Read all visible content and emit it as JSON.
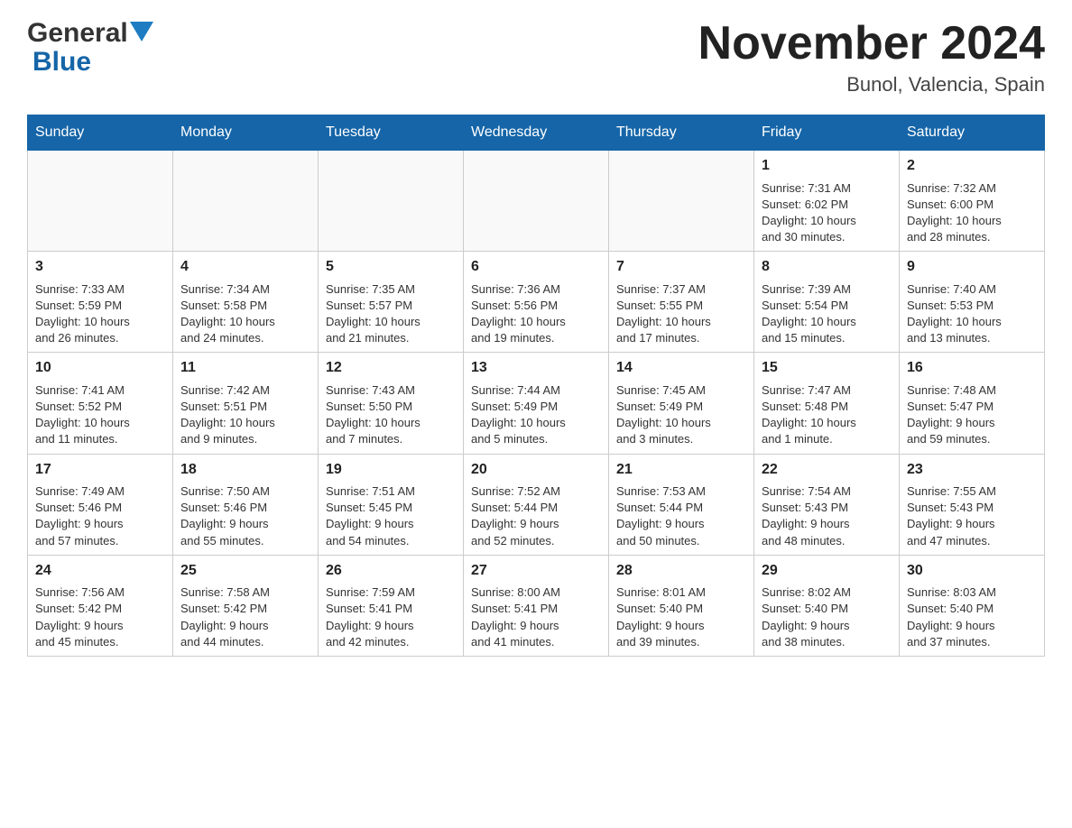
{
  "header": {
    "logo_general": "General",
    "logo_blue": "Blue",
    "month_title": "November 2024",
    "location": "Bunol, Valencia, Spain"
  },
  "weekdays": [
    "Sunday",
    "Monday",
    "Tuesday",
    "Wednesday",
    "Thursday",
    "Friday",
    "Saturday"
  ],
  "weeks": [
    [
      {
        "day": "",
        "info": ""
      },
      {
        "day": "",
        "info": ""
      },
      {
        "day": "",
        "info": ""
      },
      {
        "day": "",
        "info": ""
      },
      {
        "day": "",
        "info": ""
      },
      {
        "day": "1",
        "info": "Sunrise: 7:31 AM\nSunset: 6:02 PM\nDaylight: 10 hours\nand 30 minutes."
      },
      {
        "day": "2",
        "info": "Sunrise: 7:32 AM\nSunset: 6:00 PM\nDaylight: 10 hours\nand 28 minutes."
      }
    ],
    [
      {
        "day": "3",
        "info": "Sunrise: 7:33 AM\nSunset: 5:59 PM\nDaylight: 10 hours\nand 26 minutes."
      },
      {
        "day": "4",
        "info": "Sunrise: 7:34 AM\nSunset: 5:58 PM\nDaylight: 10 hours\nand 24 minutes."
      },
      {
        "day": "5",
        "info": "Sunrise: 7:35 AM\nSunset: 5:57 PM\nDaylight: 10 hours\nand 21 minutes."
      },
      {
        "day": "6",
        "info": "Sunrise: 7:36 AM\nSunset: 5:56 PM\nDaylight: 10 hours\nand 19 minutes."
      },
      {
        "day": "7",
        "info": "Sunrise: 7:37 AM\nSunset: 5:55 PM\nDaylight: 10 hours\nand 17 minutes."
      },
      {
        "day": "8",
        "info": "Sunrise: 7:39 AM\nSunset: 5:54 PM\nDaylight: 10 hours\nand 15 minutes."
      },
      {
        "day": "9",
        "info": "Sunrise: 7:40 AM\nSunset: 5:53 PM\nDaylight: 10 hours\nand 13 minutes."
      }
    ],
    [
      {
        "day": "10",
        "info": "Sunrise: 7:41 AM\nSunset: 5:52 PM\nDaylight: 10 hours\nand 11 minutes."
      },
      {
        "day": "11",
        "info": "Sunrise: 7:42 AM\nSunset: 5:51 PM\nDaylight: 10 hours\nand 9 minutes."
      },
      {
        "day": "12",
        "info": "Sunrise: 7:43 AM\nSunset: 5:50 PM\nDaylight: 10 hours\nand 7 minutes."
      },
      {
        "day": "13",
        "info": "Sunrise: 7:44 AM\nSunset: 5:49 PM\nDaylight: 10 hours\nand 5 minutes."
      },
      {
        "day": "14",
        "info": "Sunrise: 7:45 AM\nSunset: 5:49 PM\nDaylight: 10 hours\nand 3 minutes."
      },
      {
        "day": "15",
        "info": "Sunrise: 7:47 AM\nSunset: 5:48 PM\nDaylight: 10 hours\nand 1 minute."
      },
      {
        "day": "16",
        "info": "Sunrise: 7:48 AM\nSunset: 5:47 PM\nDaylight: 9 hours\nand 59 minutes."
      }
    ],
    [
      {
        "day": "17",
        "info": "Sunrise: 7:49 AM\nSunset: 5:46 PM\nDaylight: 9 hours\nand 57 minutes."
      },
      {
        "day": "18",
        "info": "Sunrise: 7:50 AM\nSunset: 5:46 PM\nDaylight: 9 hours\nand 55 minutes."
      },
      {
        "day": "19",
        "info": "Sunrise: 7:51 AM\nSunset: 5:45 PM\nDaylight: 9 hours\nand 54 minutes."
      },
      {
        "day": "20",
        "info": "Sunrise: 7:52 AM\nSunset: 5:44 PM\nDaylight: 9 hours\nand 52 minutes."
      },
      {
        "day": "21",
        "info": "Sunrise: 7:53 AM\nSunset: 5:44 PM\nDaylight: 9 hours\nand 50 minutes."
      },
      {
        "day": "22",
        "info": "Sunrise: 7:54 AM\nSunset: 5:43 PM\nDaylight: 9 hours\nand 48 minutes."
      },
      {
        "day": "23",
        "info": "Sunrise: 7:55 AM\nSunset: 5:43 PM\nDaylight: 9 hours\nand 47 minutes."
      }
    ],
    [
      {
        "day": "24",
        "info": "Sunrise: 7:56 AM\nSunset: 5:42 PM\nDaylight: 9 hours\nand 45 minutes."
      },
      {
        "day": "25",
        "info": "Sunrise: 7:58 AM\nSunset: 5:42 PM\nDaylight: 9 hours\nand 44 minutes."
      },
      {
        "day": "26",
        "info": "Sunrise: 7:59 AM\nSunset: 5:41 PM\nDaylight: 9 hours\nand 42 minutes."
      },
      {
        "day": "27",
        "info": "Sunrise: 8:00 AM\nSunset: 5:41 PM\nDaylight: 9 hours\nand 41 minutes."
      },
      {
        "day": "28",
        "info": "Sunrise: 8:01 AM\nSunset: 5:40 PM\nDaylight: 9 hours\nand 39 minutes."
      },
      {
        "day": "29",
        "info": "Sunrise: 8:02 AM\nSunset: 5:40 PM\nDaylight: 9 hours\nand 38 minutes."
      },
      {
        "day": "30",
        "info": "Sunrise: 8:03 AM\nSunset: 5:40 PM\nDaylight: 9 hours\nand 37 minutes."
      }
    ]
  ]
}
